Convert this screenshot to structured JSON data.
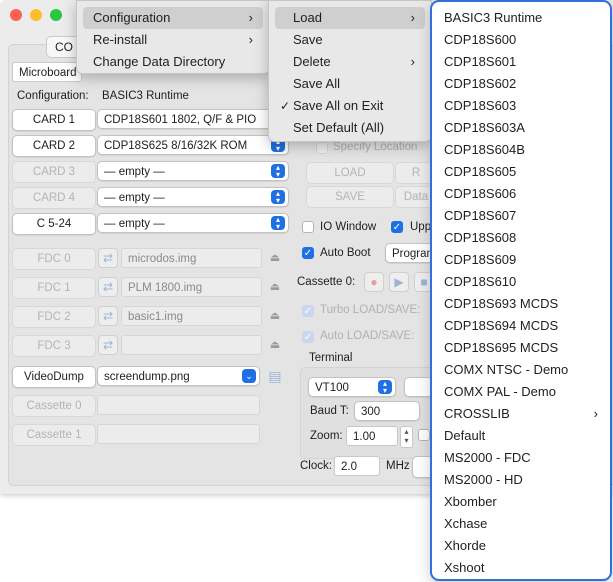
{
  "window": {
    "tab_label": "CO",
    "microboard_label": "Microboard",
    "config_label": "Configuration:",
    "config_value": "BASIC3 Runtime"
  },
  "cards": [
    {
      "label": "CARD 1",
      "value": "CDP18S601 1802, Q/F & PIO",
      "enabled": true
    },
    {
      "label": "CARD 2",
      "value": "CDP18S625 8/16/32K ROM",
      "enabled": true
    },
    {
      "label": "CARD 3",
      "value": "— empty —",
      "enabled": false
    },
    {
      "label": "CARD 4",
      "value": "— empty —",
      "enabled": false
    },
    {
      "label": "C 5-24",
      "value": "— empty —",
      "enabled": true
    }
  ],
  "fdc": [
    {
      "label": "FDC 0",
      "value": "microdos.img"
    },
    {
      "label": "FDC 1",
      "value": "PLM 1800.img"
    },
    {
      "label": "FDC 2",
      "value": "basic1.img"
    },
    {
      "label": "FDC 3",
      "value": ""
    }
  ],
  "videodump": {
    "label": "VideoDump",
    "value": "screendump.png"
  },
  "cassettes": [
    {
      "label": "Cassette 0"
    },
    {
      "label": "Cassette 1"
    }
  ],
  "right_panel": {
    "specify_location": "Specify Location",
    "load": "LOAD",
    "save": "SAVE",
    "data": "Data",
    "r_btn": "R",
    "io_window": "IO Window",
    "upp": "Upp",
    "auto_boot": "Auto Boot",
    "program": "Program",
    "cassette0": "Cassette 0:",
    "turbo": "Turbo LOAD/SAVE:",
    "auto_load": "Auto LOAD/SAVE:",
    "terminal": "Terminal",
    "terminal_type": "VT100",
    "baud_label": "Baud T:",
    "baud_value": "300",
    "zoom_label": "Zoom:",
    "zoom_value": "1.00",
    "clock_label": "Clock:",
    "clock_value": "2.0",
    "clock_unit": "MHz"
  },
  "main_menu": {
    "items": [
      {
        "label": "Configuration",
        "submenu": true,
        "selected": true
      },
      {
        "label": "Re-install",
        "submenu": true,
        "selected": false
      },
      {
        "label": "Change Data Directory",
        "submenu": false,
        "selected": false
      }
    ]
  },
  "config_menu": {
    "items": [
      {
        "label": "Load",
        "submenu": true,
        "selected": true,
        "checked": false
      },
      {
        "label": "Save",
        "submenu": false,
        "selected": false,
        "checked": false
      },
      {
        "label": "Delete",
        "submenu": true,
        "selected": false,
        "checked": false
      },
      {
        "label": "Save All",
        "submenu": false,
        "selected": false,
        "checked": false
      },
      {
        "label": "Save All on Exit",
        "submenu": false,
        "selected": false,
        "checked": true
      },
      {
        "label": "Set Default (All)",
        "submenu": false,
        "selected": false,
        "checked": false
      }
    ]
  },
  "load_menu": {
    "items": [
      "BASIC3 Runtime",
      "CDP18S600",
      "CDP18S601",
      "CDP18S602",
      "CDP18S603",
      "CDP18S603A",
      "CDP18S604B",
      "CDP18S605",
      "CDP18S606",
      "CDP18S607",
      "CDP18S608",
      "CDP18S609",
      "CDP18S610",
      "CDP18S693 MCDS",
      "CDP18S694 MCDS",
      "CDP18S695 MCDS",
      "COMX NTSC - Demo",
      "COMX PAL - Demo",
      "CROSSLIB",
      "Default",
      "MS2000 - FDC",
      "MS2000 - HD",
      "Xbomber",
      "Xchase",
      "Xhorde",
      "Xshoot"
    ],
    "submenu_item": "CROSSLIB"
  },
  "colors": {
    "accent": "#1f6fe5",
    "close": "#fe5f57",
    "minimize": "#febc2e",
    "zoom": "#28c840"
  }
}
